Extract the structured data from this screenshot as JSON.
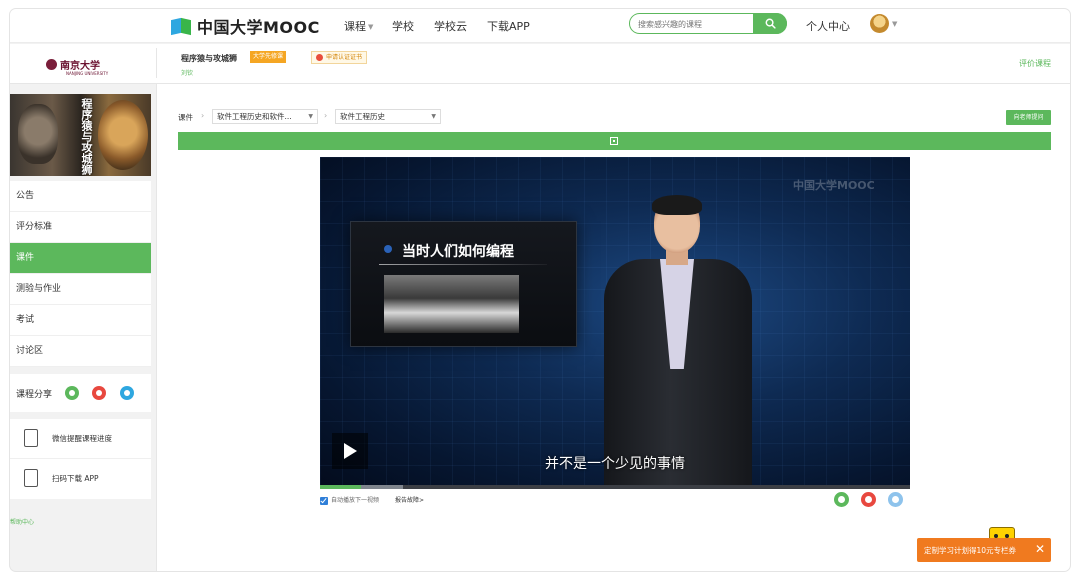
{
  "nav": {
    "brand": "中国大学MOOC",
    "items": [
      {
        "label": "课程",
        "has_dropdown": true
      },
      {
        "label": "学校"
      },
      {
        "label": "学校云"
      },
      {
        "label": "下载APP"
      }
    ],
    "search_placeholder": "搜索感兴趣的课程",
    "personal_center": "个人中心"
  },
  "course": {
    "university": "南京大学",
    "university_en": "NANJING UNIVERSITY",
    "title": "程序猿与攻城狮",
    "teacher": "刘钦",
    "badge_prereq": "大学先修课",
    "badge_cert": "申请认证证书",
    "rate_link": "评价课程"
  },
  "sidebar": {
    "cover_title": "程序猿与攻城狮",
    "menu": [
      {
        "label": "公告",
        "active": false
      },
      {
        "label": "评分标准",
        "active": false
      },
      {
        "label": "课件",
        "active": true
      },
      {
        "label": "测验与作业",
        "active": false
      },
      {
        "label": "考试",
        "active": false
      },
      {
        "label": "讨论区",
        "active": false
      }
    ],
    "share_label": "课程分享",
    "tools": [
      {
        "label": "微信提醒课程进度",
        "icon": "checklist-icon"
      },
      {
        "label": "扫码下载 APP",
        "icon": "tablet-icon"
      }
    ],
    "help": "帮助中心"
  },
  "breadcrumb": {
    "root": "课件",
    "chapter": "软件工程历史和软件...",
    "lesson": "软件工程历史"
  },
  "ask_teacher": "向老师提问",
  "video": {
    "watermark": "中国大学MOOC",
    "slide_title": "当时人们如何编程",
    "subtitle": "并不是一个少见的事情",
    "played_fraction": 0.07,
    "buffered_fraction": 0.14
  },
  "below_video": {
    "autoplay_label": "自动播放下一视频",
    "autoplay_checked": true,
    "report_link": "报告故障>"
  },
  "promo": {
    "text": "定制学习计划得10元专栏券",
    "close": "✕"
  },
  "colors": {
    "accent": "#5cb85c",
    "promo": "#f07a1f",
    "weibo": "#e8483f",
    "qq": "#2ea7e0"
  }
}
